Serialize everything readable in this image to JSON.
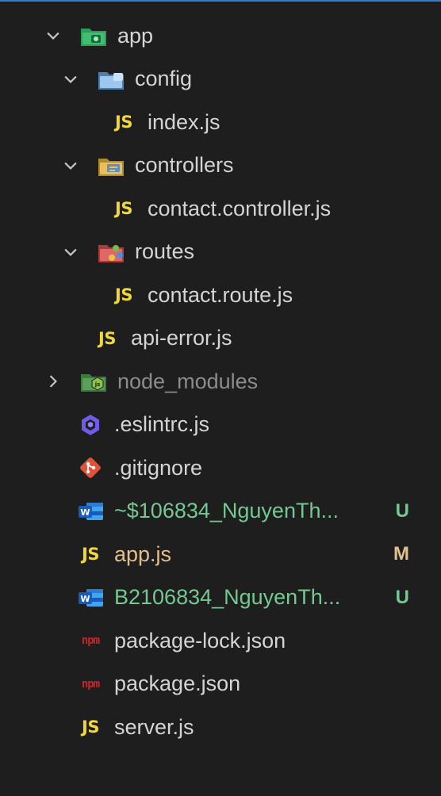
{
  "explorer": {
    "items": [
      {
        "label": "app",
        "type": "folder",
        "expanded": true,
        "icon": "folder-app-icon"
      },
      {
        "label": "config",
        "type": "folder",
        "expanded": true,
        "icon": "folder-config-icon"
      },
      {
        "label": "index.js",
        "type": "file",
        "icon": "js-file-icon",
        "icon_text": "JS"
      },
      {
        "label": "controllers",
        "type": "folder",
        "expanded": true,
        "icon": "folder-controllers-icon"
      },
      {
        "label": "contact.controller.js",
        "type": "file",
        "icon": "js-file-icon",
        "icon_text": "JS"
      },
      {
        "label": "routes",
        "type": "folder",
        "expanded": true,
        "icon": "folder-routes-icon"
      },
      {
        "label": "contact.route.js",
        "type": "file",
        "icon": "js-file-icon",
        "icon_text": "JS"
      },
      {
        "label": "api-error.js",
        "type": "file",
        "icon": "js-file-icon",
        "icon_text": "JS"
      },
      {
        "label": "node_modules",
        "type": "folder",
        "expanded": false,
        "icon": "folder-node-icon"
      },
      {
        "label": ".eslintrc.js",
        "type": "file",
        "icon": "eslint-icon"
      },
      {
        "label": ".gitignore",
        "type": "file",
        "icon": "git-icon"
      },
      {
        "label": "~$106834_NguyenTh...",
        "type": "file",
        "icon": "word-doc-icon",
        "badge": "U"
      },
      {
        "label": "app.js",
        "type": "file",
        "icon": "js-file-icon",
        "icon_text": "JS",
        "badge": "M"
      },
      {
        "label": "B2106834_NguyenTh...",
        "type": "file",
        "icon": "word-doc-icon",
        "badge": "U"
      },
      {
        "label": "package-lock.json",
        "type": "file",
        "icon": "npm-icon",
        "icon_text": "npm"
      },
      {
        "label": "package.json",
        "type": "file",
        "icon": "npm-icon",
        "icon_text": "npm"
      },
      {
        "label": "server.js",
        "type": "file",
        "icon": "js-file-icon",
        "icon_text": "JS"
      }
    ]
  },
  "colors": {
    "background": "#1e1e1e",
    "text": "#d4d4d4",
    "dimmed_text": "#8c8c8c",
    "untracked_text": "#73c991",
    "modified_text": "#e2c08d",
    "accent_border": "#2f7bd1",
    "js_icon": "#f1d73c",
    "npm_icon": "#c2262a"
  }
}
